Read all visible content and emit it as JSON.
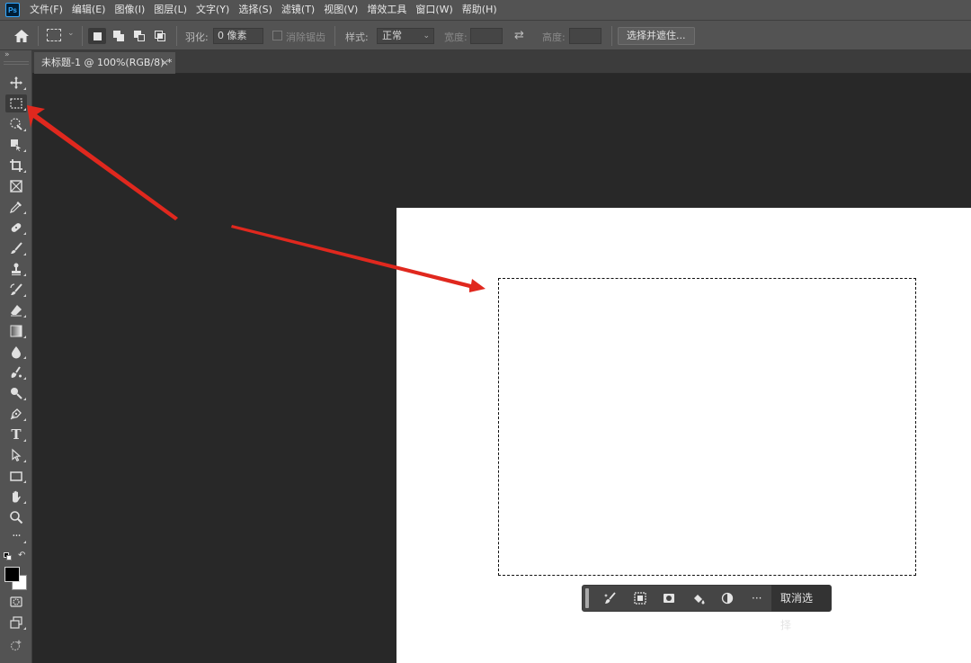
{
  "app": {
    "logo_text": "Ps"
  },
  "menu": [
    "文件(F)",
    "编辑(E)",
    "图像(I)",
    "图层(L)",
    "文字(Y)",
    "选择(S)",
    "滤镜(T)",
    "视图(V)",
    "增效工具",
    "窗口(W)",
    "帮助(H)"
  ],
  "options": {
    "feather_label": "羽化:",
    "feather_value": "0 像素",
    "antialias_label": "消除锯齿",
    "style_label": "样式:",
    "style_value": "正常",
    "width_label": "宽度:",
    "height_label": "高度:",
    "select_mask_button": "选择并遮住..."
  },
  "tab": {
    "title": "未标题-1 @ 100%(RGB/8) *",
    "close": "×"
  },
  "taskbar": {
    "deselect_label": "取消选择",
    "more_label": "···"
  },
  "toolbar": {
    "collapse": "»",
    "text_tool": "T",
    "more_tools": "···"
  },
  "colors": {
    "annotation_arrow": "#e0281e",
    "canvas_bg": "#282828",
    "panel_bg": "#535353",
    "accent": "#31a8ff"
  }
}
